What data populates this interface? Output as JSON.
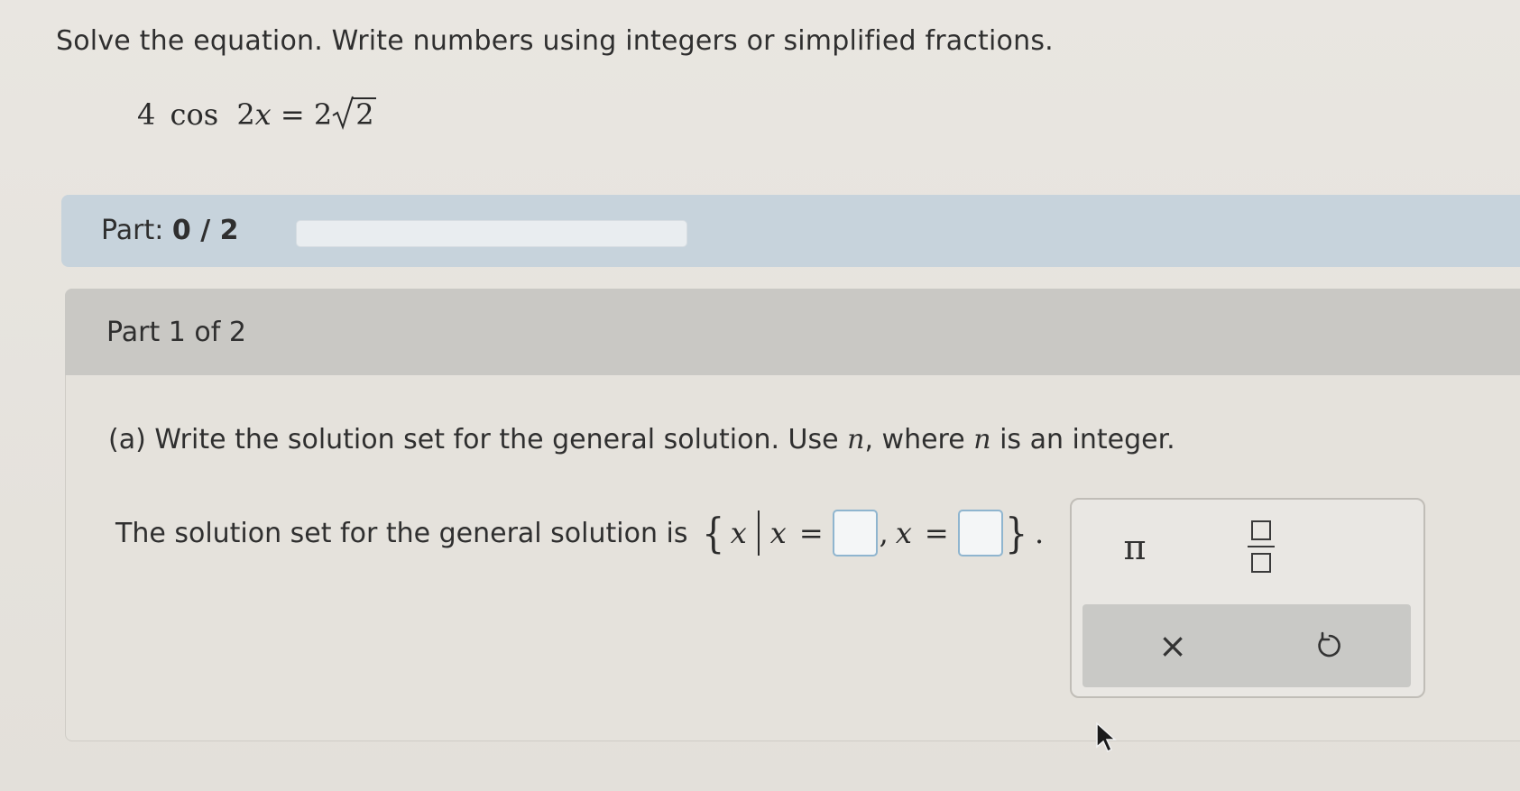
{
  "problem": {
    "instructions": "Solve the equation. Write numbers using integers or simplified fractions.",
    "equation": {
      "coef": "4",
      "func": "cos",
      "arg_coef": "2",
      "arg_var": "x",
      "equals": "=",
      "rhs_coef": "2",
      "rhs_radicand": "2"
    }
  },
  "progress": {
    "label": "Part:",
    "value": "0 / 2",
    "fraction_complete": 0
  },
  "part": {
    "header": "Part 1 of 2",
    "question_prefix": "(a) Write the solution set for the general solution. Use ",
    "question_var1": "n",
    "question_mid": ", where ",
    "question_var2": "n",
    "question_suffix": " is an integer.",
    "solution_text": "The solution set for the general solution is",
    "set_var": "x",
    "set_var2": "x",
    "set_var3": "x",
    "equals": "=",
    "comma": ",",
    "period": "."
  },
  "palette": {
    "pi_label": "π",
    "clear_label": "×"
  },
  "icons": {
    "fraction": "fraction-icon",
    "undo": "undo-icon",
    "cursor": "mouse-pointer-icon"
  },
  "colors": {
    "progress_bar_bg": "#c7d3dc",
    "answer_box_border": "#8fb5cf",
    "part_header_bg": "#c9c8c4"
  }
}
